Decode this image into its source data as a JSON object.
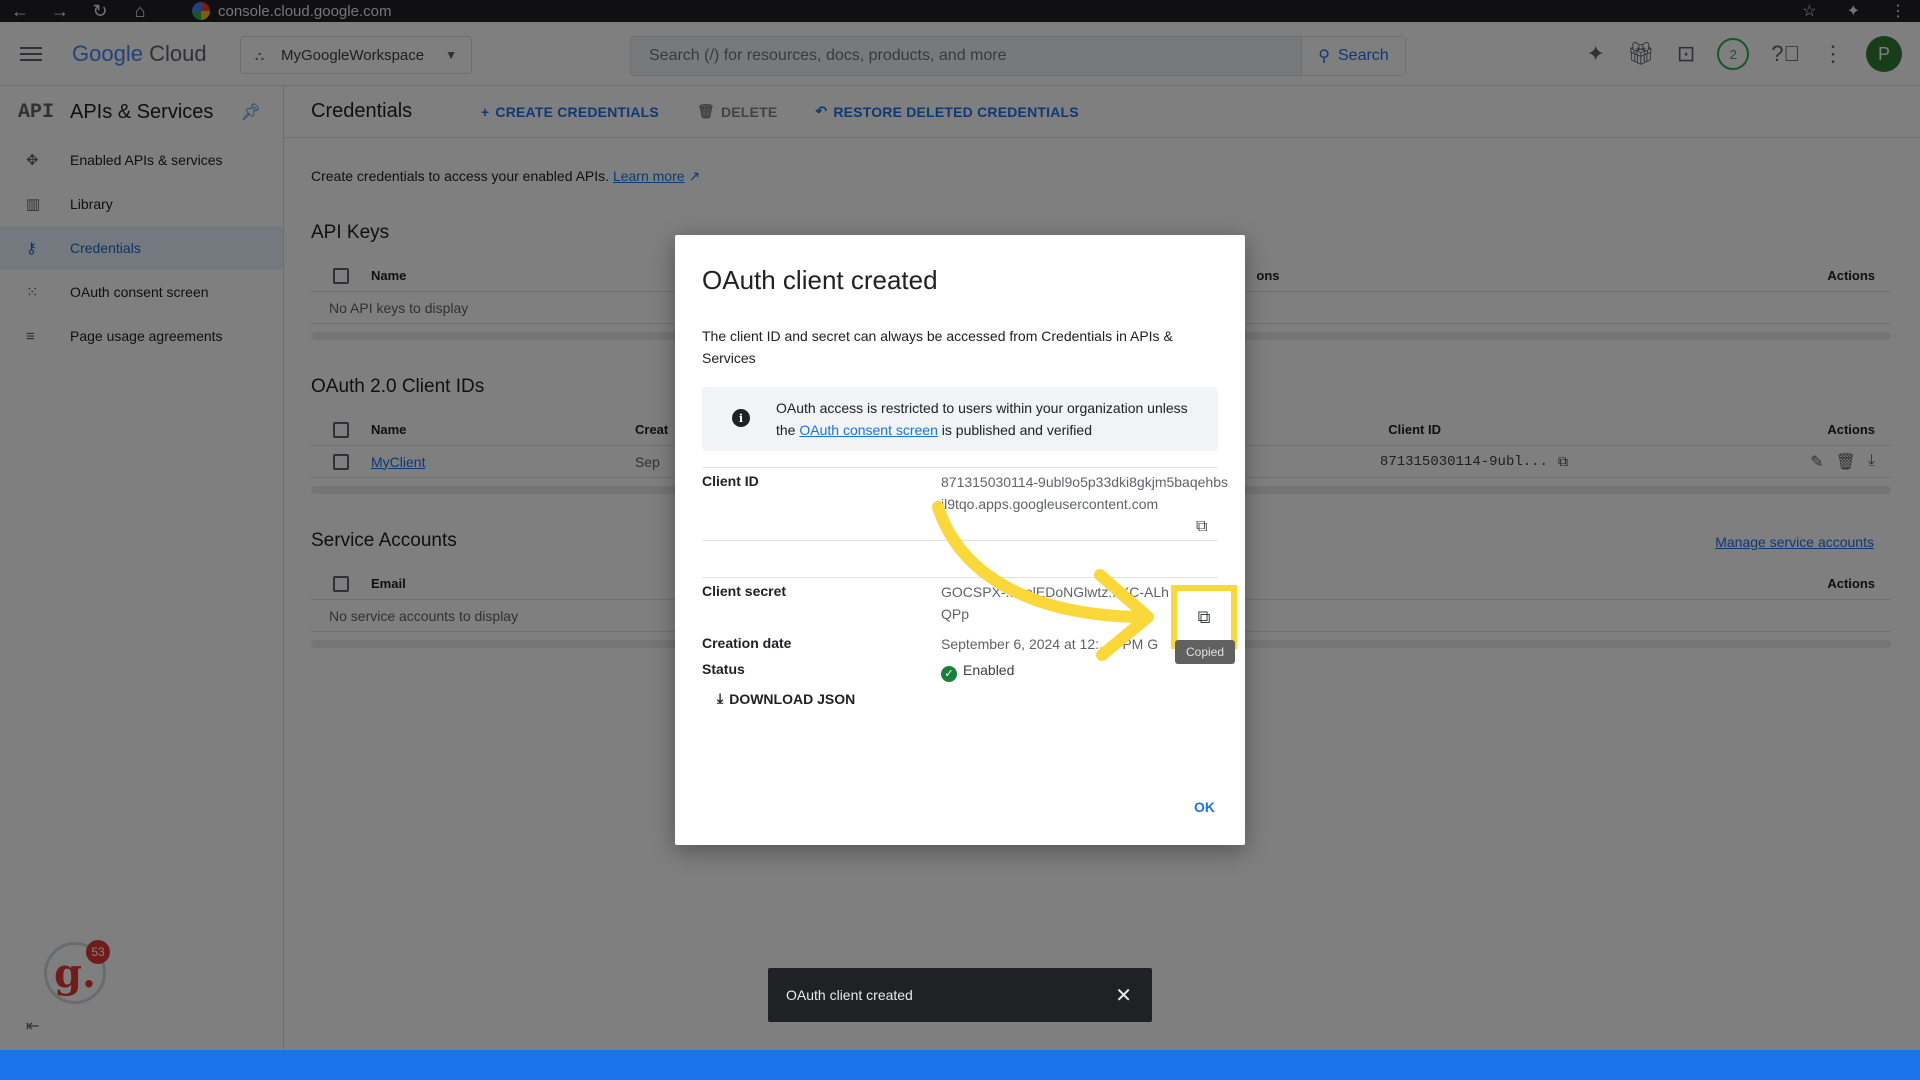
{
  "browser": {
    "url": "console.cloud.google.com",
    "nav_back": "←",
    "nav_forward": "→",
    "nav_reload": "↻",
    "nav_home": "⌂"
  },
  "header": {
    "logo_google": "Google",
    "logo_cloud": "Cloud",
    "project": "MyGoogleWorkspace",
    "search_placeholder": "Search (/) for resources, docs, products, and more",
    "search_button": "Search",
    "notification_count": "2",
    "avatar_letter": "P"
  },
  "sidebar": {
    "title": "APIs & Services",
    "api_mark": "API",
    "items": [
      {
        "label": "Enabled APIs & services",
        "icon": "✥"
      },
      {
        "label": "Library",
        "icon": "▥"
      },
      {
        "label": "Credentials",
        "icon": "⚷"
      },
      {
        "label": "OAuth consent screen",
        "icon": "⁙"
      },
      {
        "label": "Page usage agreements",
        "icon": "≡"
      }
    ],
    "active_item": "Credentials",
    "guidde_count": "53",
    "guidde_letter": "g."
  },
  "main": {
    "title": "Credentials",
    "create_label": "CREATE CREDENTIALS",
    "delete_label": "DELETE",
    "restore_label": "RESTORE DELETED CREDENTIALS",
    "intro_text": "Create credentials to access your enabled APIs.",
    "learn_more": "Learn more",
    "api_keys": {
      "title": "API Keys",
      "col_name": "Name",
      "col_restrictions": "ons",
      "col_actions": "Actions",
      "empty": "No API keys to display"
    },
    "oauth": {
      "title": "OAuth 2.0 Client IDs",
      "col_name": "Name",
      "col_created": "Creat",
      "col_client_id": "Client ID",
      "col_actions": "Actions",
      "row_name": "MyClient",
      "row_created": "Sep",
      "row_client_id": "871315030114-9ubl..."
    },
    "service_accounts": {
      "title": "Service Accounts",
      "manage_link": "Manage service accounts",
      "col_email": "Email",
      "col_actions": "Actions",
      "empty": "No service accounts to display"
    }
  },
  "dialog": {
    "title": "OAuth client created",
    "description": "The client ID and secret can always be accessed from Credentials in APIs & Services",
    "info_prefix": "OAuth access is restricted to users within your organization unless the",
    "info_link": "OAuth consent screen",
    "info_suffix": "is published and verified",
    "client_id_label": "Client ID",
    "client_id_value": "871315030114-9ubl9o5p33dki8gkjm5baqehbsjl9tqo.apps.googleusercontent.com",
    "client_secret_label": "Client secret",
    "client_secret_value": "GOCSPX-...eelEDoNGlwtz...XC-ALhQPp",
    "creation_date_label": "Creation date",
    "creation_date_value": "September 6, 2024 at 12:...4 PM G",
    "status_label": "Status",
    "status_value": "Enabled",
    "download_label": "DOWNLOAD JSON",
    "ok_label": "OK",
    "tooltip": "Copied"
  },
  "snackbar": {
    "message": "OAuth client created",
    "close": "✕"
  },
  "colors": {
    "accent": "#1a73e8",
    "highlight": "#fbd83a",
    "status_ok": "#188038"
  }
}
